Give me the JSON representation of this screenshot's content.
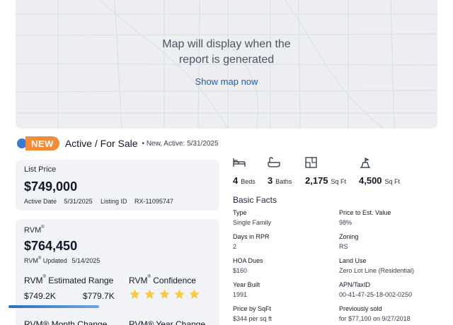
{
  "map": {
    "message": "Map will display when the report is generated",
    "link": "Show map now"
  },
  "status": {
    "badge": "NEW",
    "title": "Active / For Sale",
    "subtitle": "• New, Active: 5/31/2025"
  },
  "list_card": {
    "label": "List Price",
    "price": "$749,000",
    "active_date_label": "Active Date",
    "active_date": "5/31/2025",
    "listing_id_label": "Listing ID",
    "listing_id": "RX-11095747"
  },
  "rvm_card": {
    "label": "RVM",
    "value": "$764,450",
    "updated_label": "RVM",
    "updated_suffix": "Updated",
    "updated_date": "5/14/2025",
    "range_label": "RVM",
    "range_suffix": "Estimated Range",
    "range_low": "$749.2K",
    "range_high": "$779.7K",
    "confidence_label": "RVM",
    "confidence_suffix": "Confidence",
    "confidence_stars": 5,
    "month_change_label": "RVM® Month Change",
    "year_change_label": "RVM® Year Change",
    "colors": {
      "star": "#f6c844",
      "range_bar": "#2c6fbf"
    }
  },
  "stats": [
    {
      "icon": "bed-icon",
      "value": "4",
      "unit": "Beds"
    },
    {
      "icon": "bath-icon",
      "value": "3",
      "unit": "Baths"
    },
    {
      "icon": "floorplan-icon",
      "value": "2,175",
      "unit": "Sq Ft"
    },
    {
      "icon": "lot-icon",
      "value": "4,500",
      "unit": "Sq Ft"
    }
  ],
  "basic_facts": {
    "title": "Basic Facts",
    "left": [
      {
        "label": "Type",
        "value": "Single Family"
      },
      {
        "label": "Days in RPR",
        "value": "2"
      },
      {
        "label": "HOA Dues",
        "value": "$160"
      },
      {
        "label": "Year Built",
        "value": "1991"
      },
      {
        "label": "Price by SqFt",
        "value": "$344 per sq ft"
      }
    ],
    "right": [
      {
        "label": "Price to Est. Value",
        "value": "98%"
      },
      {
        "label": "Zoning",
        "value": "RS"
      },
      {
        "label": "Land Use",
        "value": "Zero Lot Line (Residential)"
      },
      {
        "label": "APN/TaxID",
        "value": "00-41-47-25-18-002-0250"
      },
      {
        "label": "Previously sold",
        "value": "for $77,100 on 9/27/2018"
      }
    ]
  }
}
